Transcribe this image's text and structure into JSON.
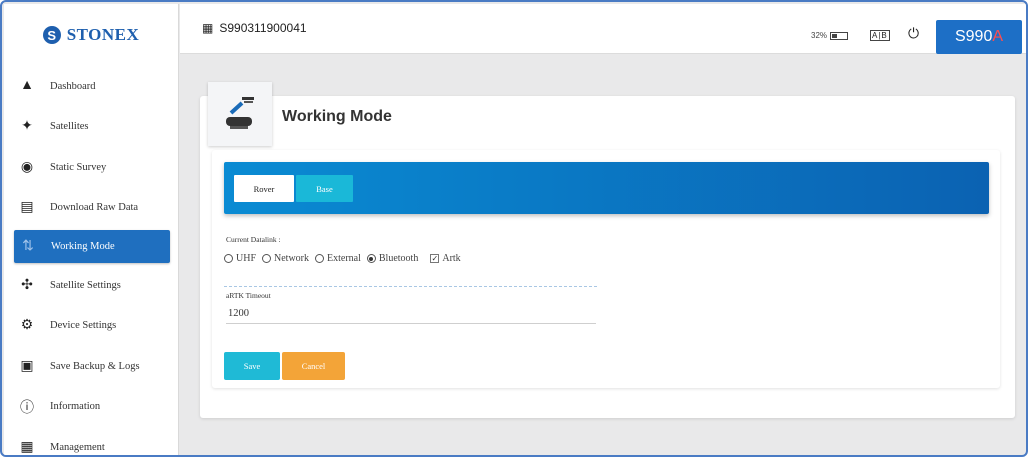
{
  "brand": {
    "name": "STONEX"
  },
  "sidebar": {
    "items": [
      {
        "label": "Dashboard",
        "icon": "tower-icon"
      },
      {
        "label": "Satellites",
        "icon": "satellite-icon"
      },
      {
        "label": "Static Survey",
        "icon": "location-pin-icon"
      },
      {
        "label": "Download Raw Data",
        "icon": "download-document-icon"
      },
      {
        "label": "Working Mode",
        "icon": "working-mode-icon",
        "active": true
      },
      {
        "label": "Satellite Settings",
        "icon": "satellite-settings-icon"
      },
      {
        "label": "Device Settings",
        "icon": "device-settings-icon"
      },
      {
        "label": "Save Backup & Logs",
        "icon": "backup-icon"
      },
      {
        "label": "Information",
        "icon": "info-icon"
      },
      {
        "label": "Management",
        "icon": "management-icon"
      }
    ]
  },
  "topbar": {
    "device_id": "S990311900041",
    "battery_text": "32%",
    "battery_level": 0.32,
    "language_badge": "A|B",
    "model_prefix": "S990",
    "model_suffix": "A"
  },
  "page": {
    "title": "Working Mode",
    "tabs": [
      {
        "label": "Rover",
        "selected": true
      },
      {
        "label": "Base",
        "selected": false
      }
    ],
    "datalink": {
      "label": "Current Datalink :",
      "options": [
        {
          "label": "UHF",
          "selected": false
        },
        {
          "label": "Network",
          "selected": false
        },
        {
          "label": "External",
          "selected": false
        },
        {
          "label": "Bluetooth",
          "selected": true
        }
      ],
      "artk": {
        "label": "Artk",
        "checked": true
      }
    },
    "timeout": {
      "label": "aRTK Timeout",
      "value": "1200"
    },
    "buttons": {
      "save": "Save",
      "cancel": "Cancel"
    }
  },
  "colors": {
    "accent_blue": "#1f6fbf",
    "tab_base": "#1ab8d8",
    "save": "#1fbad6",
    "cancel": "#f3a438",
    "model_suffix": "#ff4d4d"
  }
}
